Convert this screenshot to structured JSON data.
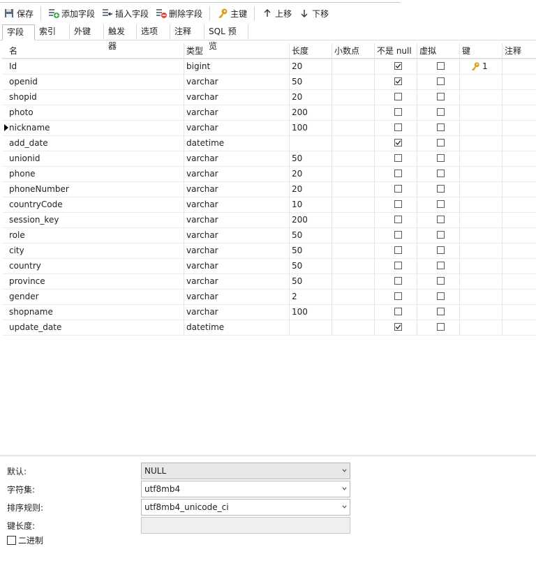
{
  "toolbar": {
    "save": "保存",
    "add_field": "添加字段",
    "insert_field": "插入字段",
    "delete_field": "删除字段",
    "primary_key": "主键",
    "move_up": "上移",
    "move_down": "下移"
  },
  "tabs": [
    "字段",
    "索引",
    "外键",
    "触发器",
    "选项",
    "注释",
    "SQL 预览"
  ],
  "columns": [
    "名",
    "类型",
    "长度",
    "小数点",
    "不是 null",
    "虚拟",
    "键",
    "注释"
  ],
  "rows": [
    {
      "name": "Id",
      "type": "bigint",
      "length": "20",
      "decimals": "",
      "not_null": true,
      "virtual": false,
      "key": "1"
    },
    {
      "name": "openid",
      "type": "varchar",
      "length": "50",
      "decimals": "",
      "not_null": true,
      "virtual": false,
      "key": ""
    },
    {
      "name": "shopid",
      "type": "varchar",
      "length": "20",
      "decimals": "",
      "not_null": false,
      "virtual": false,
      "key": ""
    },
    {
      "name": "photo",
      "type": "varchar",
      "length": "200",
      "decimals": "",
      "not_null": false,
      "virtual": false,
      "key": ""
    },
    {
      "name": "nickname",
      "type": "varchar",
      "length": "100",
      "decimals": "",
      "not_null": false,
      "virtual": false,
      "key": ""
    },
    {
      "name": "add_date",
      "type": "datetime",
      "length": "",
      "decimals": "",
      "not_null": true,
      "virtual": false,
      "key": ""
    },
    {
      "name": "unionid",
      "type": "varchar",
      "length": "50",
      "decimals": "",
      "not_null": false,
      "virtual": false,
      "key": ""
    },
    {
      "name": "phone",
      "type": "varchar",
      "length": "20",
      "decimals": "",
      "not_null": false,
      "virtual": false,
      "key": ""
    },
    {
      "name": "phoneNumber",
      "type": "varchar",
      "length": "20",
      "decimals": "",
      "not_null": false,
      "virtual": false,
      "key": ""
    },
    {
      "name": "countryCode",
      "type": "varchar",
      "length": "10",
      "decimals": "",
      "not_null": false,
      "virtual": false,
      "key": ""
    },
    {
      "name": "session_key",
      "type": "varchar",
      "length": "200",
      "decimals": "",
      "not_null": false,
      "virtual": false,
      "key": ""
    },
    {
      "name": "role",
      "type": "varchar",
      "length": "50",
      "decimals": "",
      "not_null": false,
      "virtual": false,
      "key": ""
    },
    {
      "name": "city",
      "type": "varchar",
      "length": "50",
      "decimals": "",
      "not_null": false,
      "virtual": false,
      "key": ""
    },
    {
      "name": "country",
      "type": "varchar",
      "length": "50",
      "decimals": "",
      "not_null": false,
      "virtual": false,
      "key": ""
    },
    {
      "name": "province",
      "type": "varchar",
      "length": "50",
      "decimals": "",
      "not_null": false,
      "virtual": false,
      "key": ""
    },
    {
      "name": "gender",
      "type": "varchar",
      "length": "2",
      "decimals": "",
      "not_null": false,
      "virtual": false,
      "key": ""
    },
    {
      "name": "shopname",
      "type": "varchar",
      "length": "100",
      "decimals": "",
      "not_null": false,
      "virtual": false,
      "key": ""
    },
    {
      "name": "update_date",
      "type": "datetime",
      "length": "",
      "decimals": "",
      "not_null": true,
      "virtual": false,
      "key": ""
    }
  ],
  "current_row_index": 4,
  "properties": {
    "default_label": "默认:",
    "default_value": "NULL",
    "charset_label": "字符集:",
    "charset_value": "utf8mb4",
    "collation_label": "排序规则:",
    "collation_value": "utf8mb4_unicode_ci",
    "key_length_label": "键长度:",
    "key_length_value": "",
    "binary_label": "二进制",
    "binary_checked": false
  },
  "colors": {
    "key_icon": "#d9a21a",
    "delete_icon": "#e2462f",
    "add_icon": "#3aa043"
  }
}
